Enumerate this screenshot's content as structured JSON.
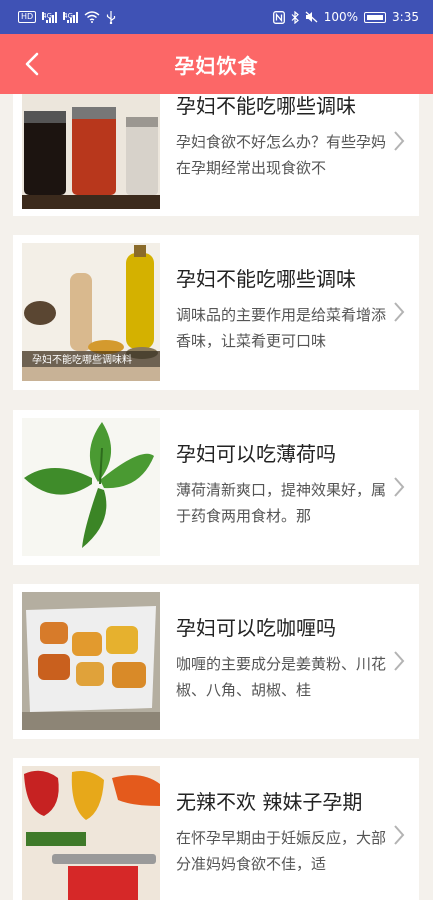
{
  "status_bar": {
    "hd_badge": "HD",
    "network1": "4G",
    "network2": "4G",
    "battery_percent": "100%",
    "time": "3:35"
  },
  "header": {
    "title": "孕妇饮食"
  },
  "articles": [
    {
      "title": "孕妇不能吃哪些调味",
      "desc": "孕妇食欲不好怎么办？有些孕妈在孕期经常出现食欲不",
      "image": "condiment-bottles"
    },
    {
      "title": "孕妇不能吃哪些调味",
      "desc": "调味品的主要作用是给菜肴增添香味，让菜肴更可口味",
      "image": "spices-and-oil",
      "image_caption": "孕妇不能吃哪些调味料"
    },
    {
      "title": "孕妇可以吃薄荷吗",
      "desc": "薄荷清新爽口，提神效果好，属于药食两用食材。那",
      "image": "mint-leaves"
    },
    {
      "title": "孕妇可以吃咖喱吗",
      "desc": "咖喱的主要成分是姜黄粉、川花椒、八角、胡椒、桂",
      "image": "curry-dish"
    },
    {
      "title": "无辣不欢 辣妹子孕期",
      "desc": "在怀孕早期由于妊娠反应，大部分准妈妈食欲不佳，适",
      "image": "peppers-cutting-board"
    }
  ]
}
